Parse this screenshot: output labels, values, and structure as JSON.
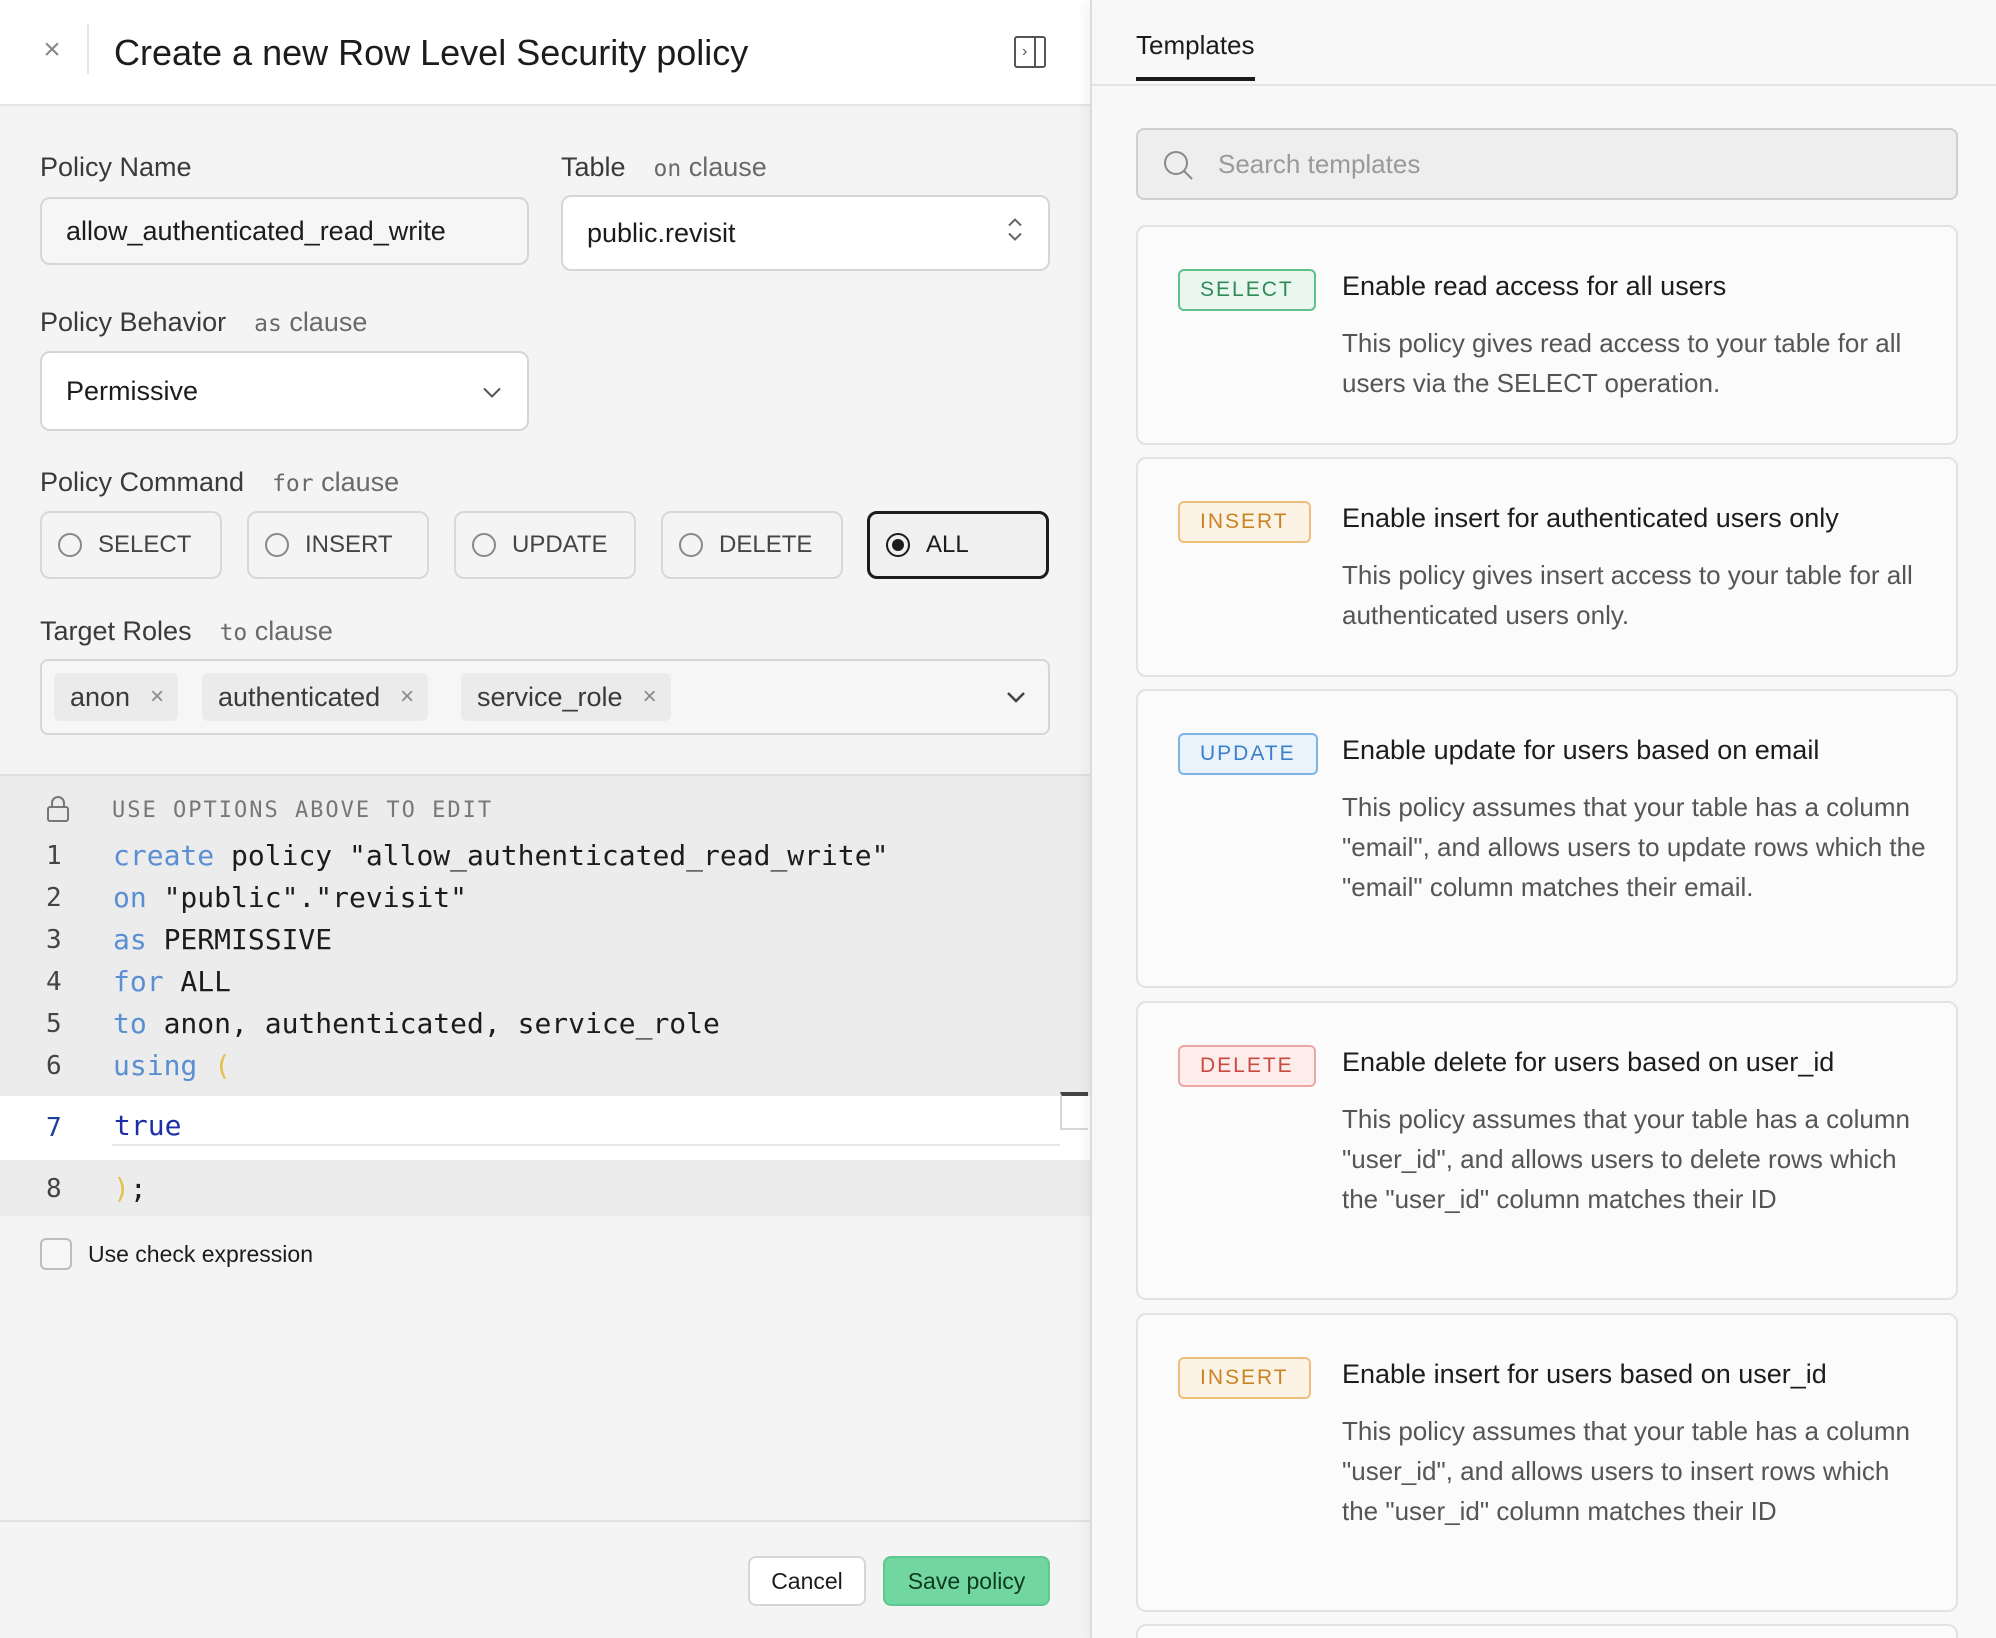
{
  "header": {
    "title": "Create a new Row Level Security policy"
  },
  "form": {
    "policy_name_label": "Policy Name",
    "policy_name_value": "allow_authenticated_read_write",
    "table_label": "Table",
    "table_clause_kw": "on",
    "table_clause_word": "clause",
    "table_value": "public.revisit",
    "behavior_label": "Policy Behavior",
    "behavior_clause_kw": "as",
    "behavior_clause_word": "clause",
    "behavior_value": "Permissive",
    "command_label": "Policy Command",
    "command_clause_kw": "for",
    "command_clause_word": "clause",
    "commands": [
      "SELECT",
      "INSERT",
      "UPDATE",
      "DELETE",
      "ALL"
    ],
    "selected_command": "ALL",
    "roles_label": "Target Roles",
    "roles_clause_kw": "to",
    "roles_clause_word": "clause",
    "roles": [
      "anon",
      "authenticated",
      "service_role"
    ]
  },
  "code": {
    "hint": "USE OPTIONS ABOVE TO EDIT",
    "lines": [
      {
        "n": "1",
        "kw": "create",
        "rest": " policy \"allow_authenticated_read_write\""
      },
      {
        "n": "2",
        "kw": "on",
        "rest": " \"public\".\"revisit\""
      },
      {
        "n": "3",
        "kw": "as",
        "rest": " PERMISSIVE"
      },
      {
        "n": "4",
        "kw": "for",
        "rest": " ALL"
      },
      {
        "n": "5",
        "kw": "to",
        "rest": " anon, authenticated, service_role"
      },
      {
        "n": "6",
        "kw": "using",
        "rest": " ("
      }
    ],
    "editable_line_number": "7",
    "editable_line_value": "true",
    "closing_line_number": "8",
    "closing_paren": ")",
    "closing_semicolon": ";"
  },
  "check_expression_label": "Use check expression",
  "footer": {
    "cancel_label": "Cancel",
    "save_label": "Save policy"
  },
  "templates_panel": {
    "tab_label": "Templates",
    "search_placeholder": "Search templates",
    "cards": [
      {
        "badge": "SELECT",
        "title": "Enable read access for all users",
        "description": "This policy gives read access to your table for all users via the SELECT operation."
      },
      {
        "badge": "INSERT",
        "title": "Enable insert for authenticated users only",
        "description": "This policy gives insert access to your table for all authenticated users only."
      },
      {
        "badge": "UPDATE",
        "title": "Enable update for users based on email",
        "description": "This policy assumes that your table has a column \"email\", and allows users to update rows which the \"email\" column matches their email."
      },
      {
        "badge": "DELETE",
        "title": "Enable delete for users based on user_id",
        "description": "This policy assumes that your table has a column \"user_id\", and allows users to delete rows which the \"user_id\" column matches their ID"
      },
      {
        "badge": "INSERT",
        "title": "Enable insert for users based on user_id",
        "description": "This policy assumes that your table has a column \"user_id\", and allows users to insert rows which the \"user_id\" column matches their ID"
      }
    ]
  }
}
